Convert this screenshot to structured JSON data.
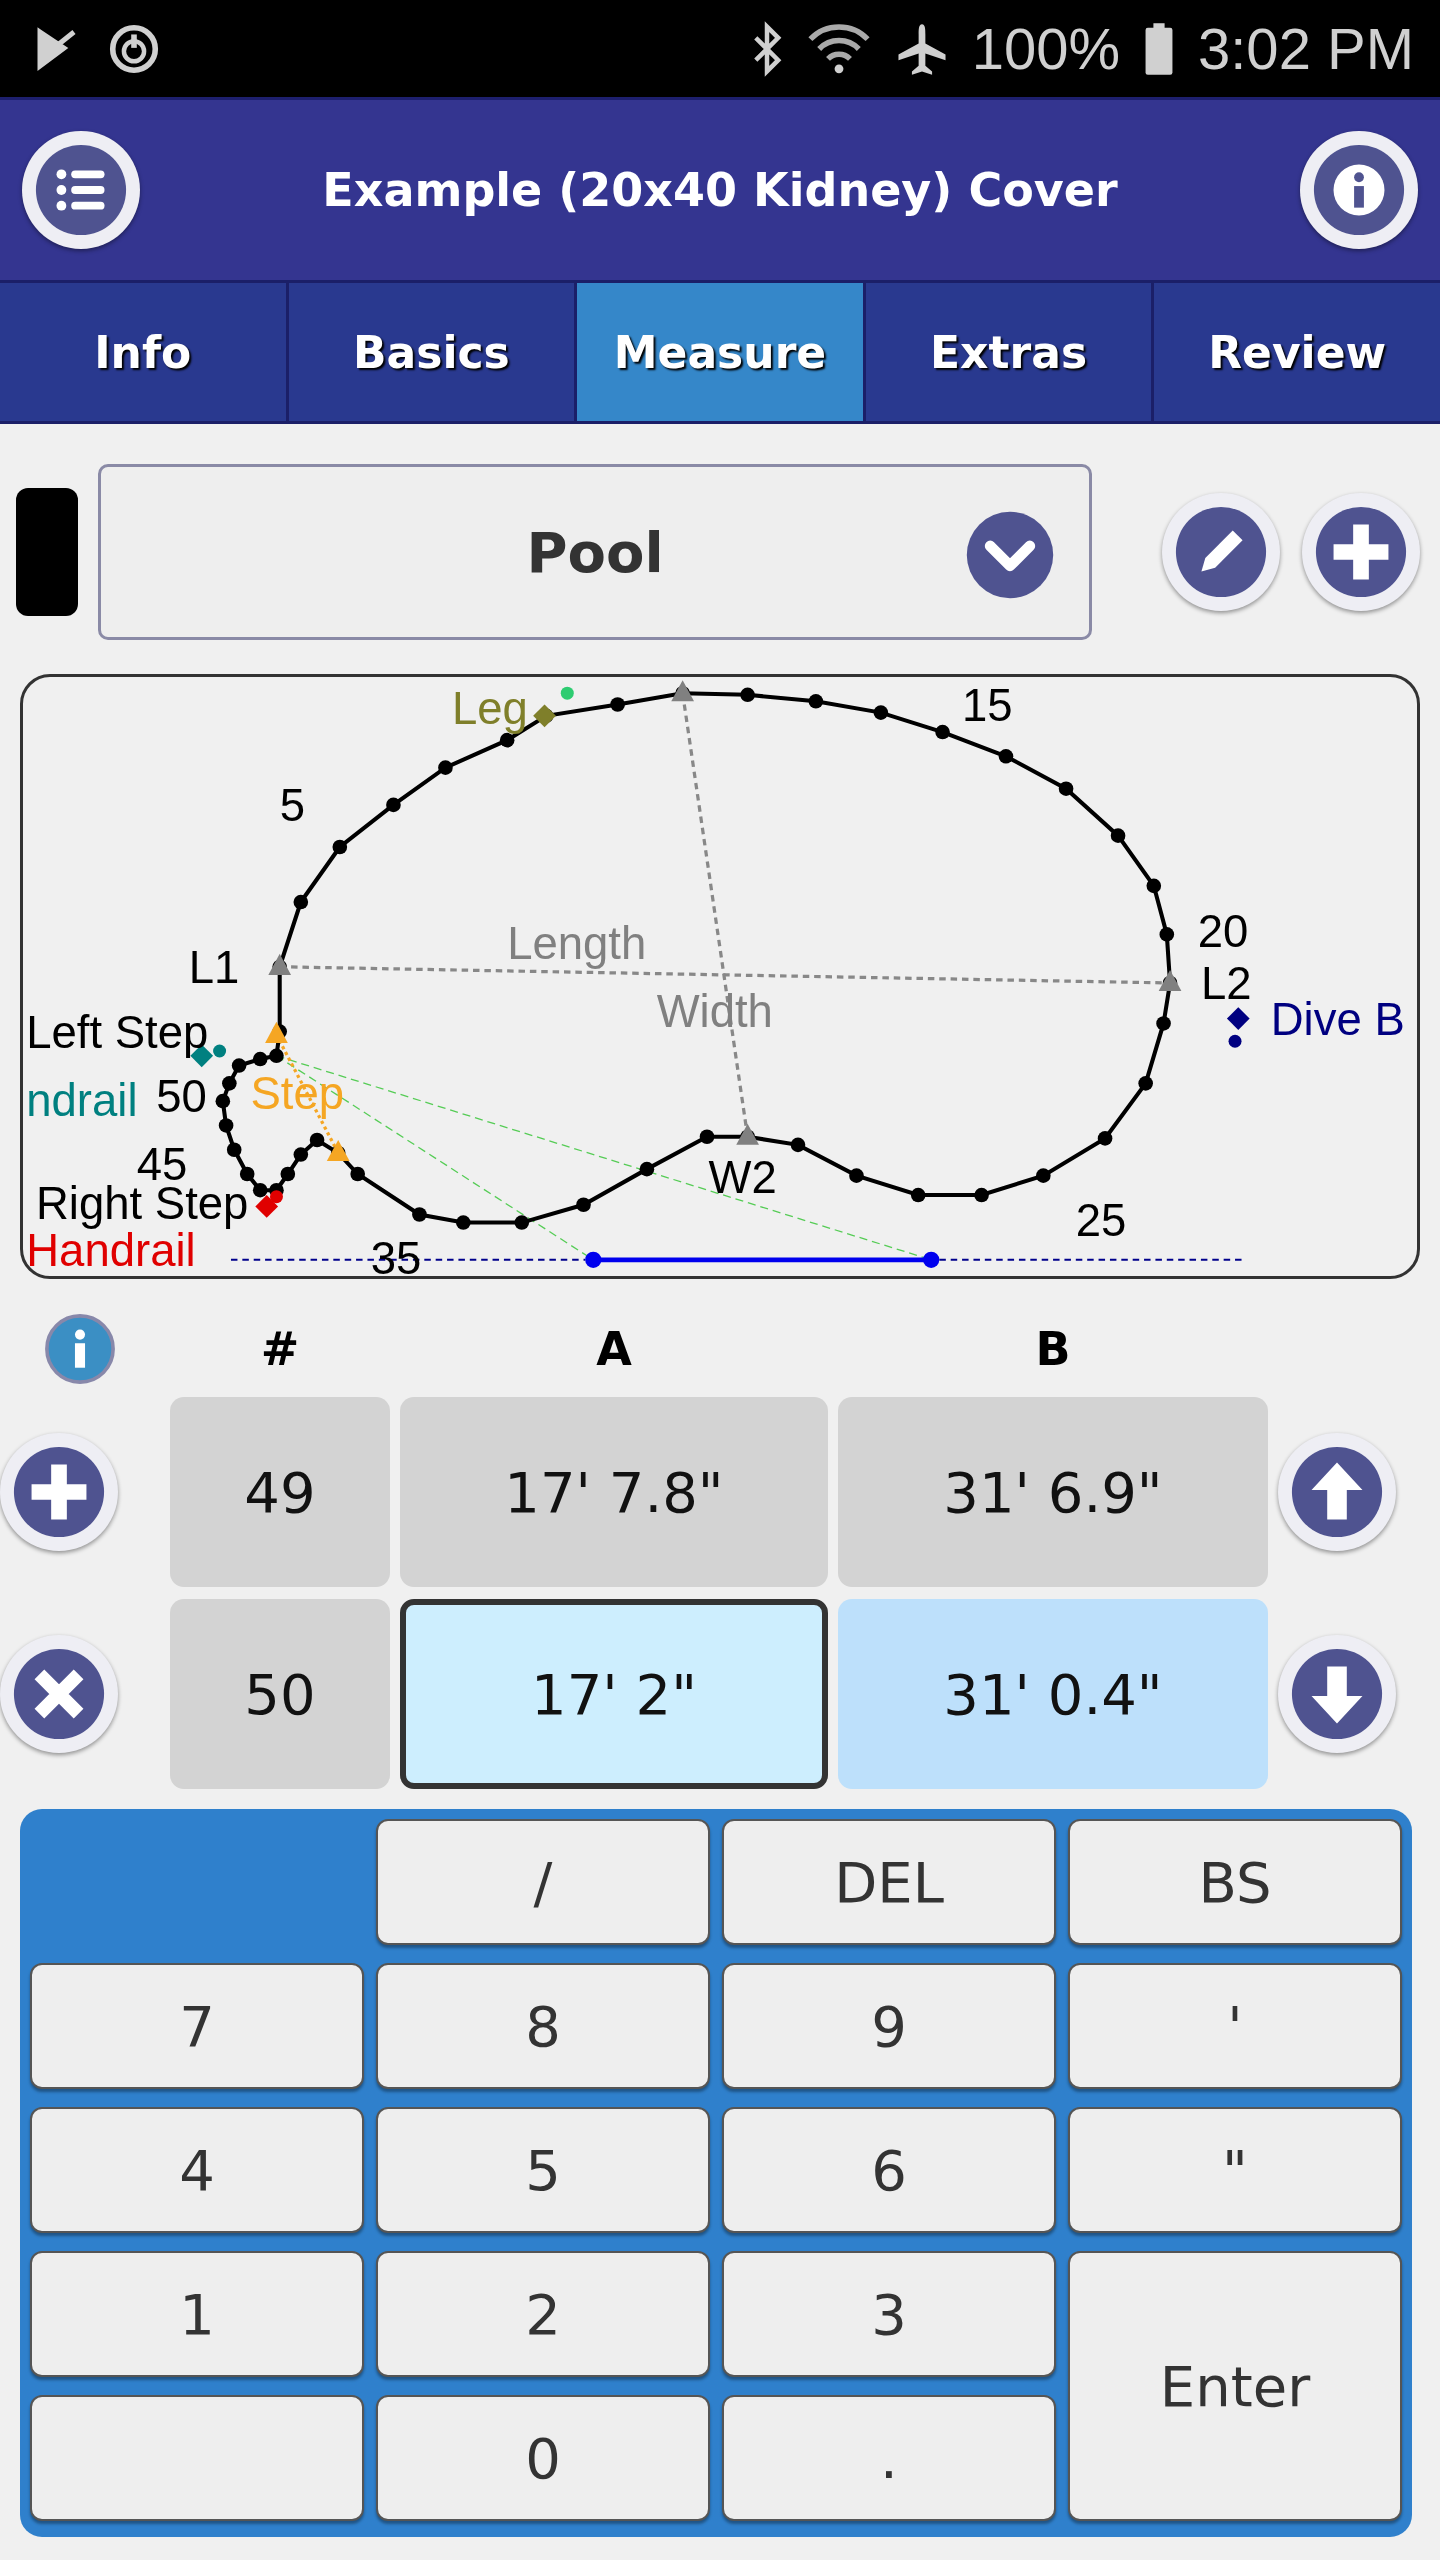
{
  "status_bar": {
    "battery_text": "100%",
    "time": "3:02 PM"
  },
  "header": {
    "title": "Example (20x40 Kidney) Cover"
  },
  "tabs": [
    {
      "label": "Info",
      "selected": false
    },
    {
      "label": "Basics",
      "selected": false
    },
    {
      "label": "Measure",
      "selected": true
    },
    {
      "label": "Extras",
      "selected": false
    },
    {
      "label": "Review",
      "selected": false
    }
  ],
  "selector": {
    "value": "Pool"
  },
  "diagram": {
    "labels": [
      {
        "text": "Leg",
        "color": "#7f7f2a"
      },
      {
        "text": "15",
        "color": "#000000"
      },
      {
        "text": "5",
        "color": "#000000"
      },
      {
        "text": "L1",
        "color": "#000000"
      },
      {
        "text": "Length",
        "color": "#808080"
      },
      {
        "text": "Width",
        "color": "#808080"
      },
      {
        "text": "20",
        "color": "#000000"
      },
      {
        "text": "L2",
        "color": "#000000"
      },
      {
        "text": "Left Step",
        "color": "#000000"
      },
      {
        "text": "Dive B",
        "color": "#000080"
      },
      {
        "text": "ndrail",
        "color": "#008080"
      },
      {
        "text": "50",
        "color": "#000000"
      },
      {
        "text": "Step",
        "color": "#f5a623"
      },
      {
        "text": "45",
        "color": "#000000"
      },
      {
        "text": "Right Step",
        "color": "#000000"
      },
      {
        "text": "Handrail",
        "color": "#e00000"
      },
      {
        "text": "35",
        "color": "#000000"
      },
      {
        "text": "W2",
        "color": "#000000"
      },
      {
        "text": "25",
        "color": "#000000"
      }
    ]
  },
  "table": {
    "columns": [
      "#",
      "A",
      "B"
    ],
    "rows": [
      {
        "cells": [
          {
            "text": "49",
            "selected": false,
            "focused": false
          },
          {
            "text": "17' 7.8\"",
            "selected": false,
            "focused": false
          },
          {
            "text": "31' 6.9\"",
            "selected": false,
            "focused": false
          }
        ]
      },
      {
        "cells": [
          {
            "text": "50",
            "selected": false,
            "focused": false
          },
          {
            "text": "17' 2\"",
            "selected": true,
            "focused": true
          },
          {
            "text": "31' 0.4\"",
            "selected": true,
            "focused": false
          }
        ]
      }
    ]
  },
  "keypad": {
    "keys": [
      {
        "kind": "gap"
      },
      {
        "kind": "key",
        "label": "/"
      },
      {
        "kind": "key",
        "label": "DEL"
      },
      {
        "kind": "key",
        "label": "BS"
      },
      {
        "kind": "key",
        "label": "7"
      },
      {
        "kind": "key",
        "label": "8"
      },
      {
        "kind": "key",
        "label": "9"
      },
      {
        "kind": "key",
        "label": "'"
      },
      {
        "kind": "key",
        "label": "4"
      },
      {
        "kind": "key",
        "label": "5"
      },
      {
        "kind": "key",
        "label": "6"
      },
      {
        "kind": "key",
        "label": "\""
      },
      {
        "kind": "key",
        "label": "1"
      },
      {
        "kind": "key",
        "label": "2"
      },
      {
        "kind": "key",
        "label": "3"
      },
      {
        "kind": "tall",
        "label": "Enter"
      },
      {
        "kind": "empty"
      },
      {
        "kind": "key",
        "label": "0"
      },
      {
        "kind": "key",
        "label": "."
      }
    ]
  }
}
